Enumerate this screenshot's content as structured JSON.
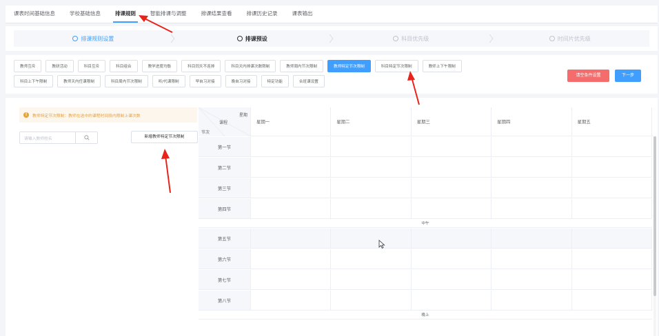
{
  "topnav": {
    "tabs": [
      {
        "label": "课表时间基础信息"
      },
      {
        "label": "学校基础信息"
      },
      {
        "label": "排课规则"
      },
      {
        "label": "智能排课与调整"
      },
      {
        "label": "排课结果查看"
      },
      {
        "label": "排课历史记录"
      },
      {
        "label": "课表输出"
      }
    ],
    "active_index": 2
  },
  "steps": [
    {
      "label": "排课规则设置",
      "state": "done"
    },
    {
      "label": "排课预设",
      "state": "current"
    },
    {
      "label": "科目优先级",
      "state": "pending"
    },
    {
      "label": "时间片优先级",
      "state": "pending"
    }
  ],
  "rules": {
    "row1": [
      "教师互斥",
      "教研活动",
      "科目互斥",
      "科目组合",
      "教学进度均衡",
      "科目同天不连排",
      "科目天内排课次数限制",
      "教师周内节次限制",
      "教师特定节次限制",
      "科目特定节次限制",
      "教师上下午限制"
    ],
    "row2": [
      "科目上下午限制",
      "教师天内任课限制",
      "科目周内节次限制",
      "听/代课限制",
      "早自习对接",
      "晚自习对接",
      "特定功能",
      "合班课设置"
    ],
    "active": "教师特定节次限制",
    "clear_label": "请空条件设置",
    "next_label": "下一步"
  },
  "content": {
    "notice": "教师特定节次限制：教师在选中的课程时间段内限制上课次数",
    "search_placeholder": "请输入教师姓名",
    "add_button": "新增教师特定节次限制",
    "header": {
      "week": "星期",
      "course": "课程",
      "period": "节次"
    },
    "days": [
      "星期一",
      "星期二",
      "星期三",
      "星期四",
      "星期五"
    ],
    "morning_periods": [
      "第一节",
      "第二节",
      "第三节",
      "第四节"
    ],
    "noon_label": "中午",
    "afternoon_periods": [
      "第五节",
      "第六节",
      "第七节",
      "第八节"
    ],
    "evening_label": "晚上"
  },
  "colors": {
    "primary": "#409eff",
    "danger": "#f56c6c",
    "warning": "#e6a23c",
    "annotation": "#e8231a"
  },
  "icons": [
    "search-icon",
    "warning-icon",
    "chevron-right-icon",
    "mouse-cursor-icon"
  ]
}
